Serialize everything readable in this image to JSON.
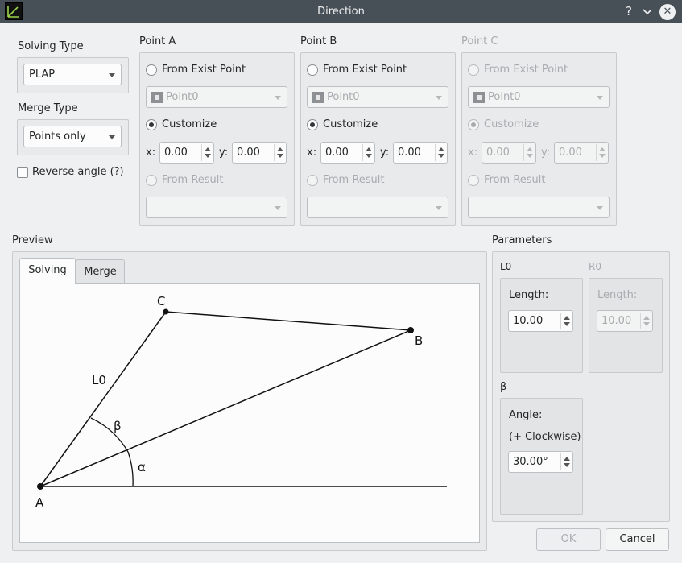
{
  "window": {
    "title": "Direction",
    "help_label": "?",
    "minimize_label": "∨",
    "close_label": "✕"
  },
  "solving_type": {
    "label": "Solving Type",
    "value": "PLAP"
  },
  "merge_type": {
    "label": "Merge Type",
    "value": "Points only"
  },
  "reverse_angle": {
    "label": "Reverse angle (?)",
    "checked": false
  },
  "point_a": {
    "title": "Point A",
    "from_exist_label": "From Exist Point",
    "exist_value": "Point0",
    "customize_label": "Customize",
    "x_label": "x:",
    "x_value": "0.00",
    "y_label": "y:",
    "y_value": "0.00",
    "from_result_label": "From Result",
    "result_value": ""
  },
  "point_b": {
    "title": "Point B",
    "from_exist_label": "From Exist Point",
    "exist_value": "Point0",
    "customize_label": "Customize",
    "x_label": "x:",
    "x_value": "0.00",
    "y_label": "y:",
    "y_value": "0.00",
    "from_result_label": "From Result",
    "result_value": ""
  },
  "point_c": {
    "title": "Point C",
    "from_exist_label": "From Exist Point",
    "exist_value": "Point0",
    "customize_label": "Customize",
    "x_label": "x:",
    "x_value": "0.00",
    "y_label": "y:",
    "y_value": "0.00",
    "from_result_label": "From Result",
    "result_value": ""
  },
  "preview": {
    "label": "Preview",
    "tabs": [
      {
        "label": "Solving"
      },
      {
        "label": "Merge"
      }
    ],
    "diagram": {
      "A": "A",
      "B": "B",
      "C": "C",
      "L0": "L0",
      "beta": "β",
      "alpha": "α"
    }
  },
  "parameters": {
    "label": "Parameters",
    "l0": {
      "title": "L0",
      "length_label": "Length:",
      "length_value": "10.00"
    },
    "r0": {
      "title": "R0",
      "length_label": "Length:",
      "length_value": "10.00"
    },
    "beta": {
      "title": "β",
      "angle_label": "Angle:",
      "angle_hint": "(+ Clockwise)",
      "angle_value": "30.00°"
    }
  },
  "buttons": {
    "ok": "OK",
    "cancel": "Cancel"
  },
  "colors": {
    "titlebar": "#475057",
    "window_bg": "#eff0f1",
    "group_bg": "#e9eaeb",
    "disabled_text": "#a8abae"
  },
  "icons": {
    "app": "app-icon",
    "help": "help-icon",
    "minimize": "chevron-down-icon",
    "close": "close-icon",
    "point": "point-icon"
  }
}
